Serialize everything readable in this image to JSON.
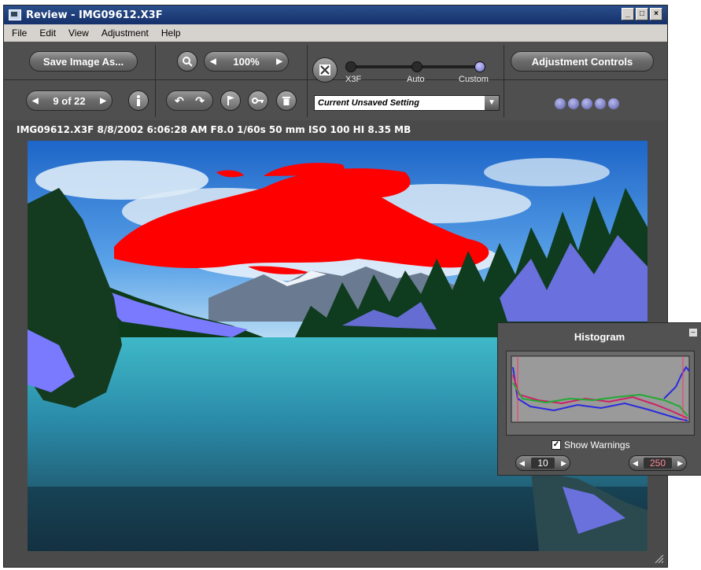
{
  "window": {
    "title": "Review - IMG09612.X3F"
  },
  "menu": [
    {
      "label": "File"
    },
    {
      "label": "Edit"
    },
    {
      "label": "View"
    },
    {
      "label": "Adjustment"
    },
    {
      "label": "Help"
    }
  ],
  "toolbar": {
    "save_label": "Save Image As...",
    "zoom_value": "100%",
    "nav_position": "9 of 22",
    "adjustment_controls_label": "Adjustment Controls",
    "mode_labels": [
      "X3F",
      "Auto",
      "Custom"
    ],
    "mode_selected": "Custom",
    "setting_select_value": "Current Unsaved Setting"
  },
  "info_bar": {
    "text": "IMG09612.X3F  8/8/2002  6:06:28 AM  F8.0  1/60s  50 mm  ISO 100  HI  8.35 MB"
  },
  "histogram": {
    "title": "Histogram",
    "show_warnings_label": "Show Warnings",
    "show_warnings_checked": true,
    "low_value": "10",
    "high_value": "250"
  },
  "colors": {
    "warning_red": "#ff0000",
    "warning_blue": "#7a7aff",
    "accent": "#6a6ac0"
  }
}
